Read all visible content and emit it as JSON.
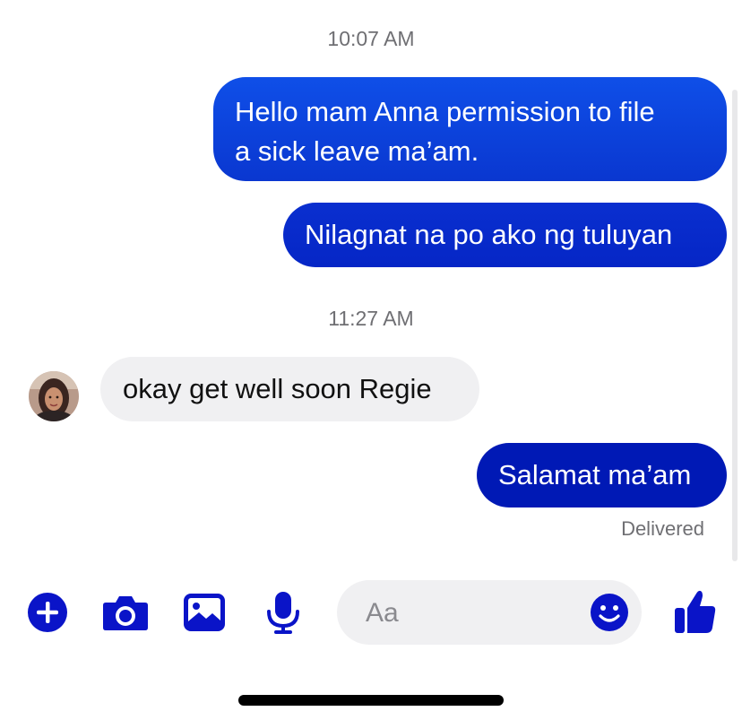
{
  "conversation": {
    "timestamp_1": "10:07 AM",
    "message_1": {
      "line_1": "Hello mam Anna permission to file",
      "line_2": "a sick leave ma’am."
    },
    "message_2": "Nilagnat na po ako ng tuluyan",
    "timestamp_2": "11:27 AM",
    "message_3": "okay get well soon Regie",
    "message_4": "Salamat ma’am",
    "delivery_status": "Delivered"
  },
  "composer": {
    "placeholder": "Aa",
    "icons": [
      "plus-icon",
      "camera-icon",
      "gallery-icon",
      "microphone-icon",
      "emoji-icon",
      "thumbs-up-icon"
    ]
  },
  "colors": {
    "outgoing_bubble_top": "#0f4fe8",
    "outgoing_bubble_bottom": "#0019b3",
    "incoming_bubble": "#f0f0f2",
    "icon_accent": "#0a14c8"
  }
}
